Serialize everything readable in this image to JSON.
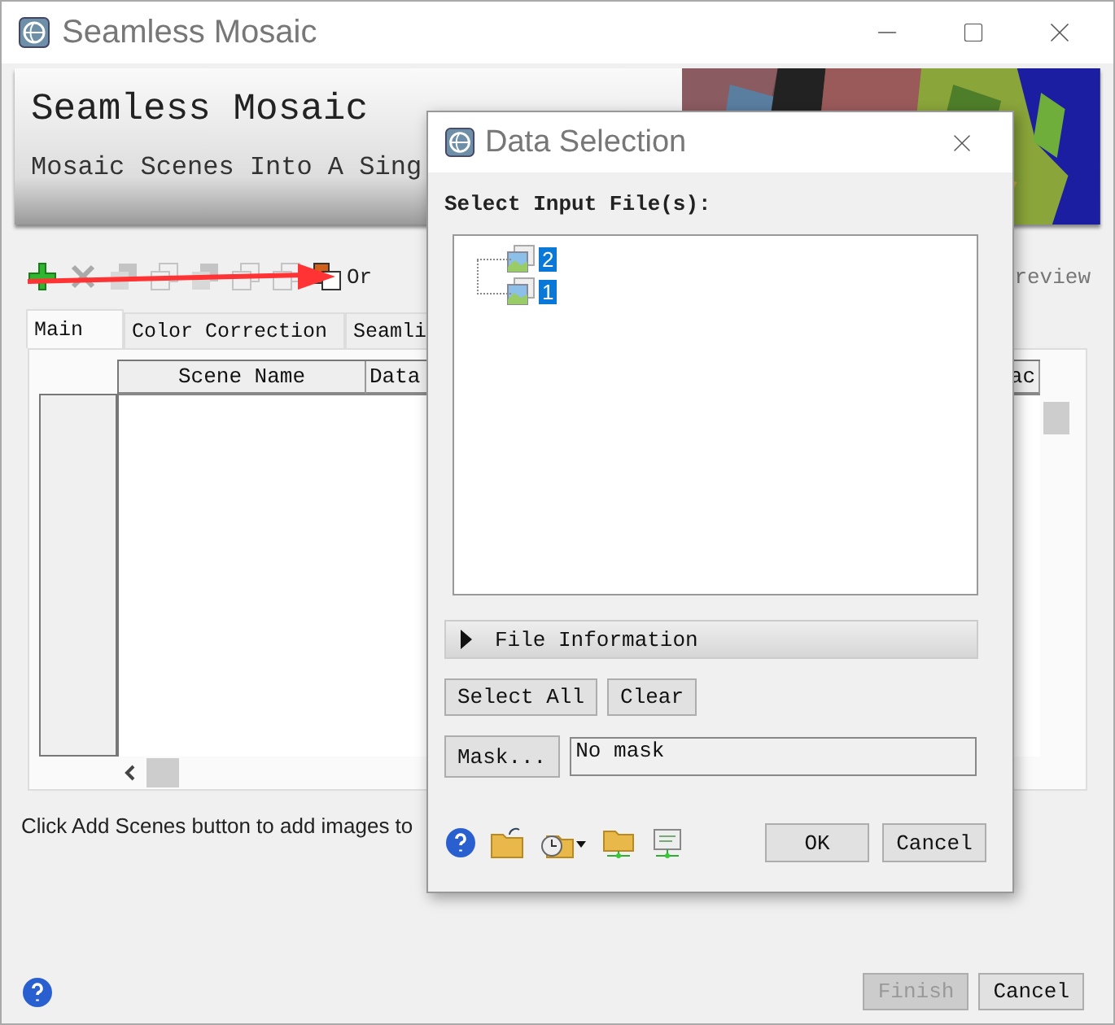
{
  "window": {
    "title": "Seamless Mosaic"
  },
  "banner": {
    "title": "Seamless Mosaic",
    "subtitle": "Mosaic Scenes Into A Sing"
  },
  "toolbar": {
    "items": [
      {
        "kind": "add",
        "disabled": false
      },
      {
        "kind": "remove",
        "disabled": true
      },
      {
        "kind": "layers",
        "disabled": true
      },
      {
        "kind": "copy",
        "disabled": true
      },
      {
        "kind": "layers",
        "disabled": true
      },
      {
        "kind": "copy",
        "disabled": true
      },
      {
        "kind": "copy",
        "disabled": true
      },
      {
        "kind": "order",
        "disabled": false
      }
    ],
    "label": "Or",
    "preview_label": "review"
  },
  "tabs": [
    {
      "label": "Main",
      "selected": true
    },
    {
      "label": "Color Correction",
      "selected": false
    },
    {
      "label": "Seamli",
      "selected": false
    }
  ],
  "table": {
    "columns": [
      "Scene Name",
      "Data",
      "ac"
    ]
  },
  "message": "Click Add Scenes button to add images to",
  "buttons": [
    {
      "label": "Finish",
      "disabled": true
    },
    {
      "label": "Cancel",
      "disabled": false
    }
  ],
  "dialog": {
    "title": "Data Selection",
    "prompt": "Select Input File(s):",
    "files": [
      {
        "label": "2",
        "selected": true
      },
      {
        "label": "1",
        "selected": true
      }
    ],
    "section": {
      "label": "File Information",
      "expanded": false
    },
    "actions": [
      "Select All",
      "Clear"
    ],
    "mask_button": "Mask...",
    "mask_field": "No mask",
    "tools": [
      {
        "kind": "help"
      },
      {
        "kind": "open"
      },
      {
        "kind": "history"
      },
      {
        "kind": "folder-net"
      },
      {
        "kind": "screen-net"
      }
    ],
    "buttons": [
      "OK",
      "Cancel"
    ]
  }
}
